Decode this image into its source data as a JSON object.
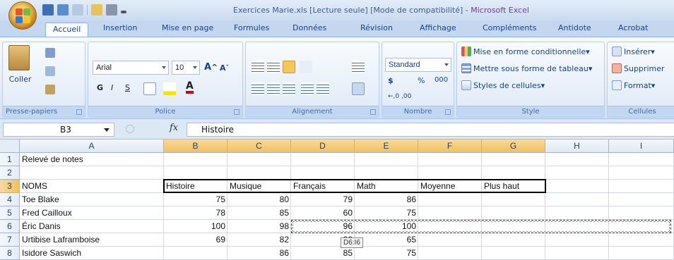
{
  "window": {
    "title_main": "Exercices Marie.xls  [Lecture seule]  [Mode de compatibilité] - ",
    "title_app": "Microsoft Excel"
  },
  "tabs": [
    "Accueil",
    "Insertion",
    "Mise en page",
    "Formules",
    "Données",
    "Révision",
    "Affichage",
    "Compléments",
    "Antidote",
    "Acrobat"
  ],
  "ribbon": {
    "clipboard": {
      "paste_label": "Coller",
      "group_label": "Presse-papiers"
    },
    "font": {
      "font_name": "Arial",
      "font_size": "10",
      "bold": "G",
      "italic": "I",
      "underline": "S",
      "font_color_letter": "A",
      "group_label": "Police"
    },
    "alignment": {
      "group_label": "Alignement"
    },
    "number": {
      "format": "Standard",
      "currency": "$",
      "percent": "%",
      "thousands": "000",
      "group_label": "Nombre"
    },
    "style": {
      "conditional": "Mise en forme conditionnelle",
      "as_table": "Mettre sous forme de tableau",
      "cell_styles": "Styles de cellules",
      "group_label": "Style"
    },
    "cells": {
      "insert": "Insérer",
      "delete": "Supprimer",
      "format": "Format",
      "group_label": "Cellules"
    }
  },
  "formula_bar": {
    "name_box": "B3",
    "fx": "fx",
    "content": "Histoire"
  },
  "grid": {
    "columns": [
      "A",
      "B",
      "C",
      "D",
      "E",
      "F",
      "G",
      "H",
      "I"
    ],
    "selected_columns": [
      "B",
      "C",
      "D",
      "E",
      "F",
      "G"
    ],
    "rows": [
      "1",
      "2",
      "3",
      "4",
      "5",
      "6",
      "7",
      "8"
    ],
    "selected_rows": [
      "3"
    ],
    "cells": {
      "A1": "Relevé de notes",
      "A3": "NOMS",
      "B3": "Histoire",
      "C3": "Musique",
      "D3": "Français",
      "E3": "Math",
      "F3": "Moyenne",
      "G3": "Plus haut",
      "A4": "Toe Blake",
      "B4": "75",
      "C4": "80",
      "D4": "79",
      "E4": "86",
      "A5": "Fred Cailloux",
      "B5": "78",
      "C5": "85",
      "D5": "60",
      "E5": "75",
      "A6": "Éric Danis",
      "B6": "100",
      "C6": "98",
      "D6": "96",
      "E6": "100",
      "A7": "Urtibise Laframboise",
      "B7": "69",
      "C7": "82",
      "D7": "80",
      "E7": "65",
      "A8": "Isidore Saswich",
      "C8": "86",
      "D8": "85",
      "E8": "75"
    },
    "drag_tooltip": "D6:I6"
  },
  "colors": {
    "ribbon_text": "#15428b",
    "header_selected": "#f1c15f",
    "title_app": "#6d3f8c"
  }
}
